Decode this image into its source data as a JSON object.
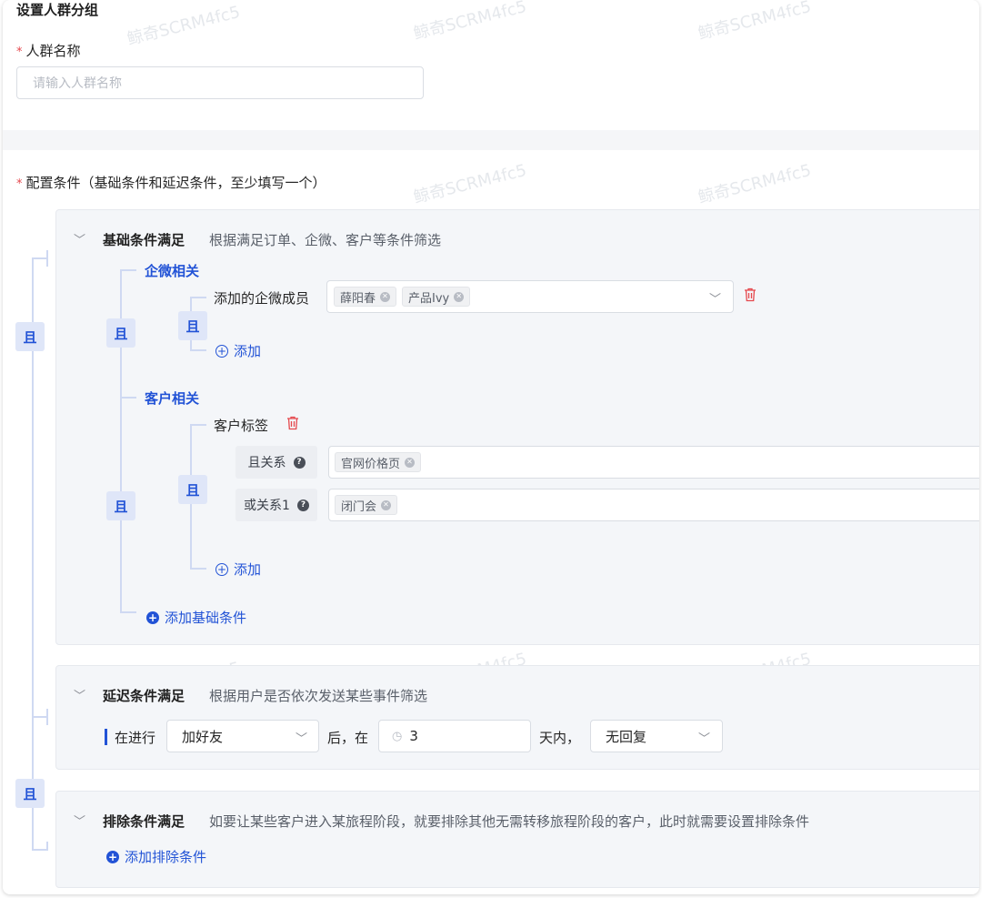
{
  "header": {
    "title": "设置人群分组"
  },
  "name_field": {
    "required_mark": "*",
    "label": "人群名称",
    "placeholder": "请输入人群名称"
  },
  "config": {
    "required_mark": "*",
    "label": "配置条件（基础条件和延迟条件，至少填写一个）",
    "and_label": "且"
  },
  "basic": {
    "title": "基础条件满足",
    "desc": "根据满足订单、企微、客户等条件筛选",
    "group_wecom": {
      "title": "企微相关",
      "field_label": "添加的企微成员",
      "tags": [
        "薛阳春",
        "产品Ivy"
      ],
      "add_label": "添加"
    },
    "group_customer": {
      "title": "客户相关",
      "field_label": "客户标签",
      "rel_and": {
        "label": "且关系",
        "tags": [
          "官网价格页"
        ]
      },
      "rel_or": {
        "label": "或关系1",
        "tags": [
          "闭门会"
        ]
      },
      "add_label": "添加"
    },
    "add_condition_label": "添加基础条件"
  },
  "delay": {
    "title": "延迟条件满足",
    "desc": "根据用户是否依次发送某些事件筛选",
    "in_progress_label": "在进行",
    "event_value": "加好友",
    "after_label": "后，在",
    "days_value": "3",
    "within_label": "天内，",
    "reply_value": "无回复"
  },
  "exclude": {
    "title": "排除条件满足",
    "desc": "如要让某些客户进入某旅程阶段，就要排除其他无需转移旅程阶段的客户，此时就需要设置排除条件",
    "add_label": "添加排除条件"
  },
  "watermark": "鲸奇SCRM4fc5",
  "colors": {
    "accent": "#2253d6",
    "danger": "#e5484d",
    "panel": "#f4f6f9"
  }
}
